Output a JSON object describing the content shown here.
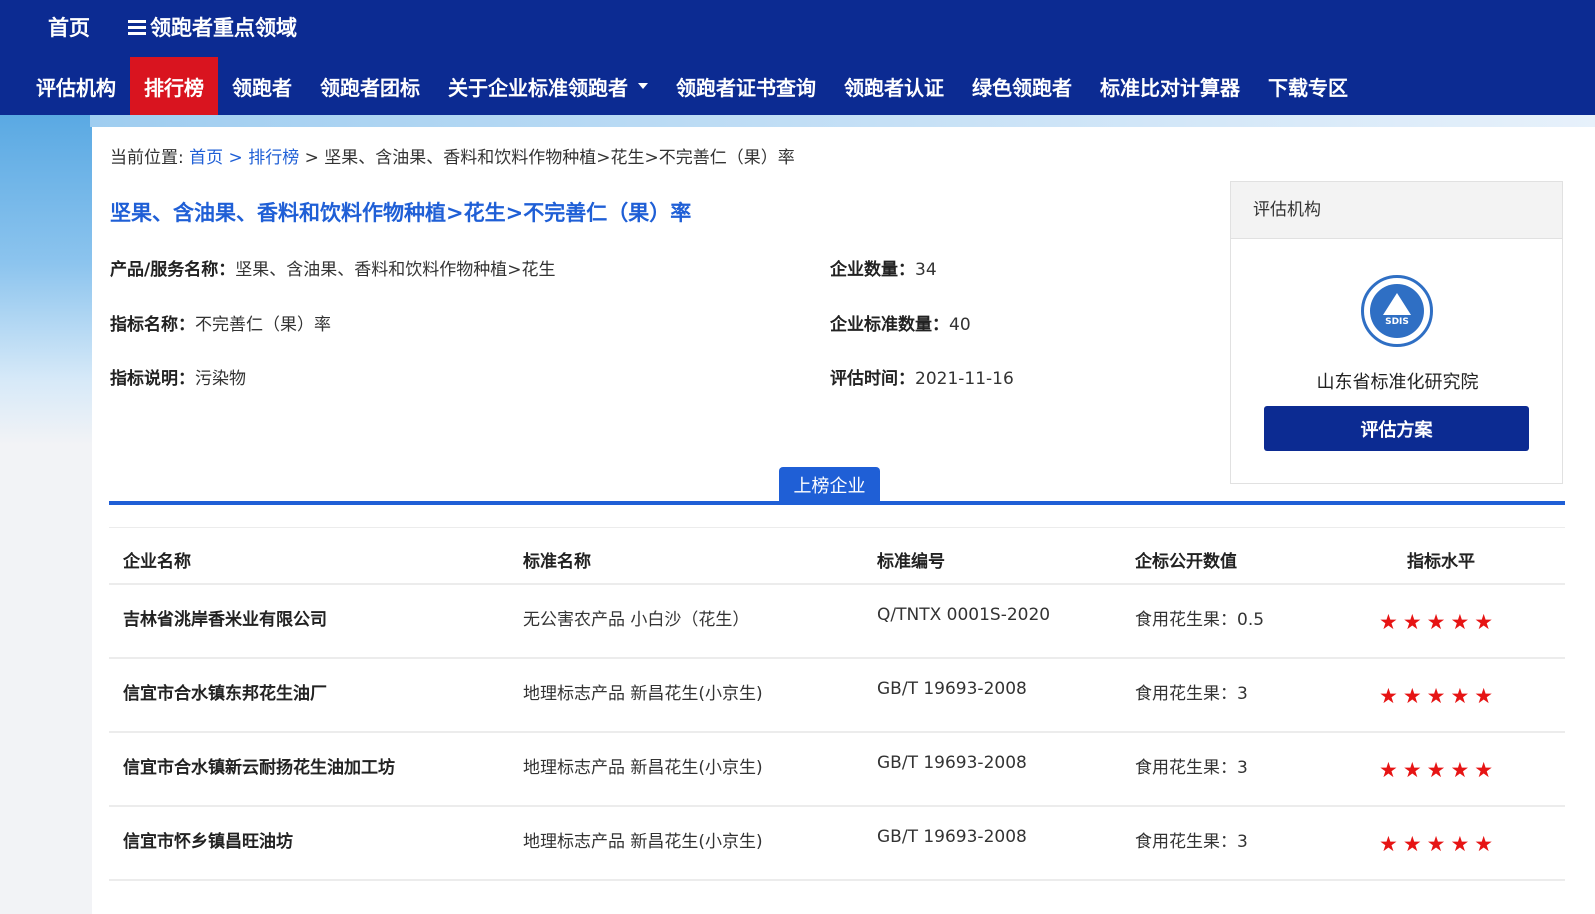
{
  "top": {
    "home": "首页",
    "domain": "领跑者重点领域"
  },
  "nav": [
    {
      "label": "评估机构",
      "active": false
    },
    {
      "label": "排行榜",
      "active": true
    },
    {
      "label": "领跑者",
      "active": false
    },
    {
      "label": "领跑者团标",
      "active": false
    },
    {
      "label": "关于企业标准领跑者",
      "active": false,
      "dropdown": true
    },
    {
      "label": "领跑者证书查询",
      "active": false
    },
    {
      "label": "领跑者认证",
      "active": false
    },
    {
      "label": "绿色领跑者",
      "active": false
    },
    {
      "label": "标准比对计算器",
      "active": false
    },
    {
      "label": "下载专区",
      "active": false
    }
  ],
  "breadcrumb": {
    "prefix": "当前位置: ",
    "home": "首页",
    "sep1": " > ",
    "ranking": "排行榜",
    "rest": " > 坚果、含油果、香料和饮料作物种植>花生>不完善仁（果）率"
  },
  "title": "坚果、含油果、香料和饮料作物种植>花生>不完善仁（果）率",
  "info": {
    "product_label": "产品/服务名称：",
    "product_value": "坚果、含油果、香料和饮料作物种植>花生",
    "indicator_label": "指标名称：",
    "indicator_value": "不完善仁（果）率",
    "desc_label": "指标说明：",
    "desc_value": "污染物",
    "companies_label": "企业数量：",
    "companies_value": "34",
    "standards_label": "企业标准数量：",
    "standards_value": "40",
    "time_label": "评估时间：",
    "time_value": "2021-11-16"
  },
  "side": {
    "header": "评估机构",
    "logo_text": "SDIS",
    "org": "山东省标准化研究院",
    "button": "评估方案"
  },
  "tab": "上榜企业",
  "table": {
    "headers": [
      "企业名称",
      "标准名称",
      "标准编号",
      "企标公开数值",
      "指标水平"
    ],
    "rows": [
      {
        "company": "吉林省洮岸香米业有限公司",
        "standard": "无公害农产品 小白沙（花生）",
        "code": "Q/TNTX 0001S-2020",
        "value": "食用花生果：0.5",
        "stars": "★★★★★"
      },
      {
        "company": "信宜市合水镇东邦花生油厂",
        "standard": "地理标志产品 新昌花生(小京生)",
        "code": "GB/T 19693-2008",
        "value": "食用花生果：3",
        "stars": "★★★★★"
      },
      {
        "company": "信宜市合水镇新云耐扬花生油加工坊",
        "standard": "地理标志产品 新昌花生(小京生)",
        "code": "GB/T 19693-2008",
        "value": "食用花生果：3",
        "stars": "★★★★★"
      },
      {
        "company": "信宜市怀乡镇昌旺油坊",
        "standard": "地理标志产品 新昌花生(小京生)",
        "code": "GB/T 19693-2008",
        "value": "食用花生果：3",
        "stars": "★★★★★"
      }
    ]
  },
  "colors": {
    "nav_bg": "#0c2b92",
    "active": "#d9141f",
    "link": "#1f5fd6",
    "star": "#e61414"
  }
}
